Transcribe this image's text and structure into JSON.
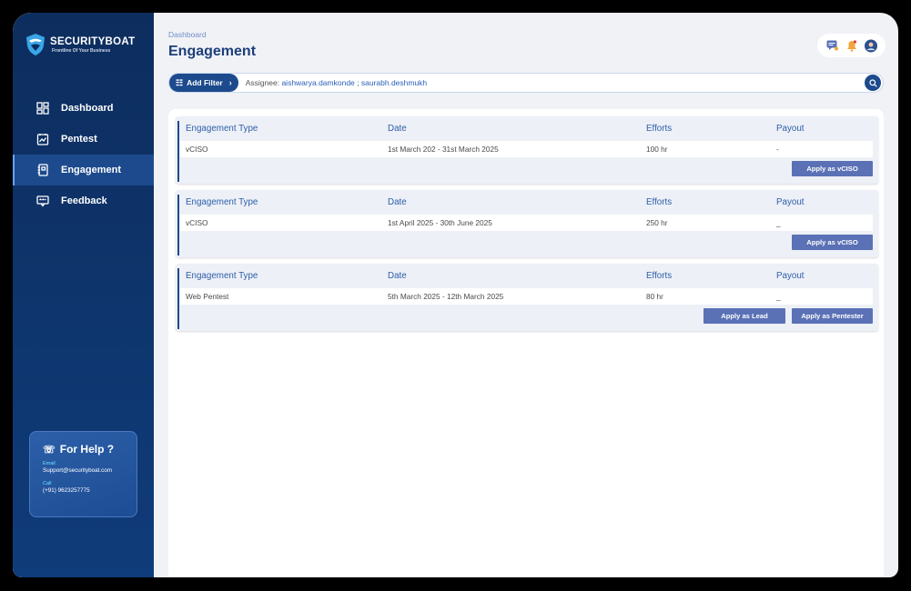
{
  "app": {
    "brand_title": "SECURITYBOAT",
    "brand_subtitle": "Frontline Of Your Business"
  },
  "sidebar": {
    "items": [
      {
        "label": "Dashboard",
        "icon": "dashboard-icon",
        "active": false
      },
      {
        "label": "Pentest",
        "icon": "pentest-icon",
        "active": false
      },
      {
        "label": "Engagement",
        "icon": "engagement-icon",
        "active": true
      },
      {
        "label": "Feedback",
        "icon": "feedback-icon",
        "active": false
      }
    ],
    "help": {
      "title": "For Help ?",
      "email_label": "Email",
      "email": "Support@securityboat.com",
      "call_label": "Call",
      "phone": "(+91) 9623257775"
    }
  },
  "header": {
    "breadcrumb": "Dashboard",
    "title": "Engagement"
  },
  "filter": {
    "add_filter_label": "Add Filter",
    "assignee_label": "Assignee: ",
    "assignee_values": "aishwarya.damkonde ; saurabh.deshmukh"
  },
  "columns": [
    "Engagement Type",
    "Date",
    "Efforts",
    "Payout"
  ],
  "engagements": [
    {
      "type": "vCISO",
      "date": "1st March 202  -  31st March 2025",
      "efforts": "100 hr",
      "payout": "-",
      "buttons": [
        "Apply as vCISO"
      ]
    },
    {
      "type": "vCISO",
      "date": "1st April 2025  -  30th June 2025",
      "efforts": "250 hr",
      "payout": "_",
      "buttons": [
        "Apply as vCISO"
      ]
    },
    {
      "type": "Web Pentest",
      "date": "5th March 2025  -  12th March 2025",
      "efforts": "80 hr",
      "payout": "_",
      "buttons": [
        "Apply as Lead",
        "Apply as Pentester"
      ]
    }
  ],
  "colors": {
    "sidebar_bg": "#0d2d5e",
    "accent": "#1c4a8c",
    "button": "#5a71b6",
    "header_text": "#2b5fa8"
  }
}
